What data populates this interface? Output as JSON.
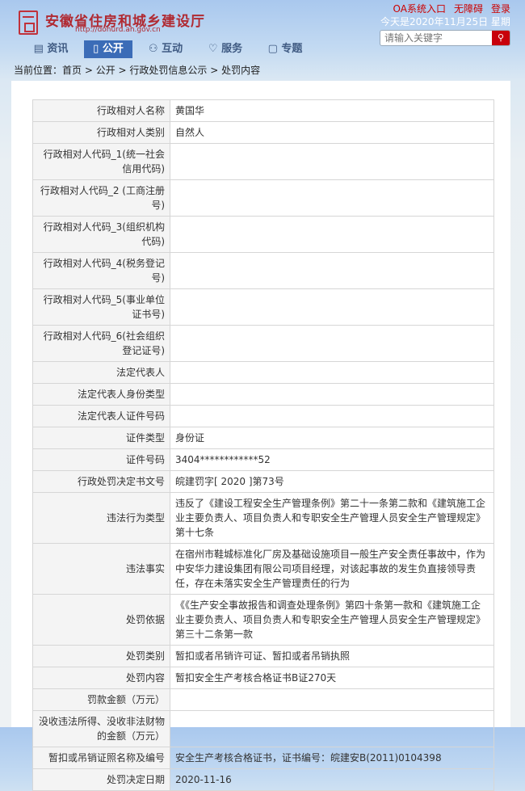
{
  "header": {
    "title": "安徽省住房和城乡建设厅",
    "url": "http://dohurd.ah.gov.cn",
    "links": [
      "OA系统入口",
      "无障碍",
      "登录"
    ],
    "date": "今天是2020年11月25日 星期",
    "search_placeholder": "请输入关键字"
  },
  "nav": [
    {
      "label": "资讯",
      "icon": "list-icon"
    },
    {
      "label": "公开",
      "icon": "book-icon"
    },
    {
      "label": "互动",
      "icon": "people-icon"
    },
    {
      "label": "服务",
      "icon": "heart-icon"
    },
    {
      "label": "专题",
      "icon": "chat-icon"
    }
  ],
  "breadcrumb": {
    "prefix": "当前位置：",
    "items": [
      "首页",
      "公开",
      "行政处罚信息公示",
      "处罚内容"
    ]
  },
  "rows": [
    {
      "label": "行政相对人名称",
      "value": "黄国华"
    },
    {
      "label": "行政相对人类别",
      "value": "自然人"
    },
    {
      "label": "行政相对人代码_1(统一社会信用代码)",
      "value": ""
    },
    {
      "label": "行政相对人代码_2 (工商注册号)",
      "value": ""
    },
    {
      "label": "行政相对人代码_3(组织机构代码)",
      "value": ""
    },
    {
      "label": "行政相对人代码_4(税务登记号)",
      "value": ""
    },
    {
      "label": "行政相对人代码_5(事业单位证书号)",
      "value": ""
    },
    {
      "label": "行政相对人代码_6(社会组织登记证号)",
      "value": ""
    },
    {
      "label": "法定代表人",
      "value": ""
    },
    {
      "label": "法定代表人身份类型",
      "value": ""
    },
    {
      "label": "法定代表人证件号码",
      "value": ""
    },
    {
      "label": "证件类型",
      "value": "身份证"
    },
    {
      "label": "证件号码",
      "value": "3404************52"
    },
    {
      "label": "行政处罚决定书文号",
      "value": "皖建罚字[ 2020 ]第73号"
    },
    {
      "label": "违法行为类型",
      "value": "违反了《建设工程安全生产管理条例》第二十一条第二款和《建筑施工企业主要负责人、项目负责人和专职安全生产管理人员安全生产管理规定》第十七条"
    },
    {
      "label": "违法事实",
      "value": "在宿州市鞋城标准化厂房及基础设施项目一般生产安全责任事故中，作为中安华力建设集团有限公司项目经理，对该起事故的发生负直接领导责任，存在未落实安全生产管理责任的行为"
    },
    {
      "label": "处罚依据",
      "value": "《《生产安全事故报告和调查处理条例》第四十条第一款和《建筑施工企业主要负责人、项目负责人和专职安全生产管理人员安全生产管理规定》第三十二条第一款"
    },
    {
      "label": "处罚类别",
      "value": "暂扣或者吊销许可证、暂扣或者吊销执照"
    },
    {
      "label": "处罚内容",
      "value": "暂扣安全生产考核合格证书B证270天"
    },
    {
      "label": "罚款金额（万元）",
      "value": ""
    },
    {
      "label": "没收违法所得、没收非法财物的金额（万元）",
      "value": ""
    },
    {
      "label": "暂扣或吊销证照名称及编号",
      "value": "安全生产考核合格证书，证书编号：皖建安B(2011)0104398"
    },
    {
      "label": "处罚决定日期",
      "value": "2020-11-16"
    }
  ]
}
